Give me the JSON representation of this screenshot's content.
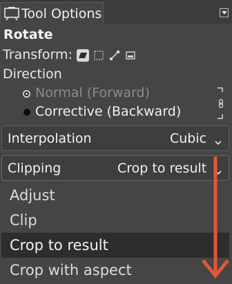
{
  "header": {
    "tab_label": "Tool Options",
    "tab_icon": "tool-options-icon",
    "menu_icon": "dock-menu-icon"
  },
  "tool": {
    "title": "Rotate",
    "transform_label": "Transform:",
    "transform_buttons": [
      "layer-icon",
      "selection-icon",
      "path-icon",
      "image-icon"
    ],
    "direction_label": "Direction",
    "direction_options": [
      {
        "label": "Normal (Forward)",
        "selected": true
      },
      {
        "label": "Corrective (Backward)",
        "selected": false
      }
    ]
  },
  "interpolation": {
    "label": "Interpolation",
    "value": "Cubic"
  },
  "clipping": {
    "label": "Clipping",
    "value": "Crop to result",
    "options": [
      "Adjust",
      "Clip",
      "Crop to result",
      "Crop with aspect"
    ],
    "highlighted": "Crop to result"
  },
  "colors": {
    "panel_bg": "#454545",
    "annotation_arrow": "#e0573a"
  }
}
